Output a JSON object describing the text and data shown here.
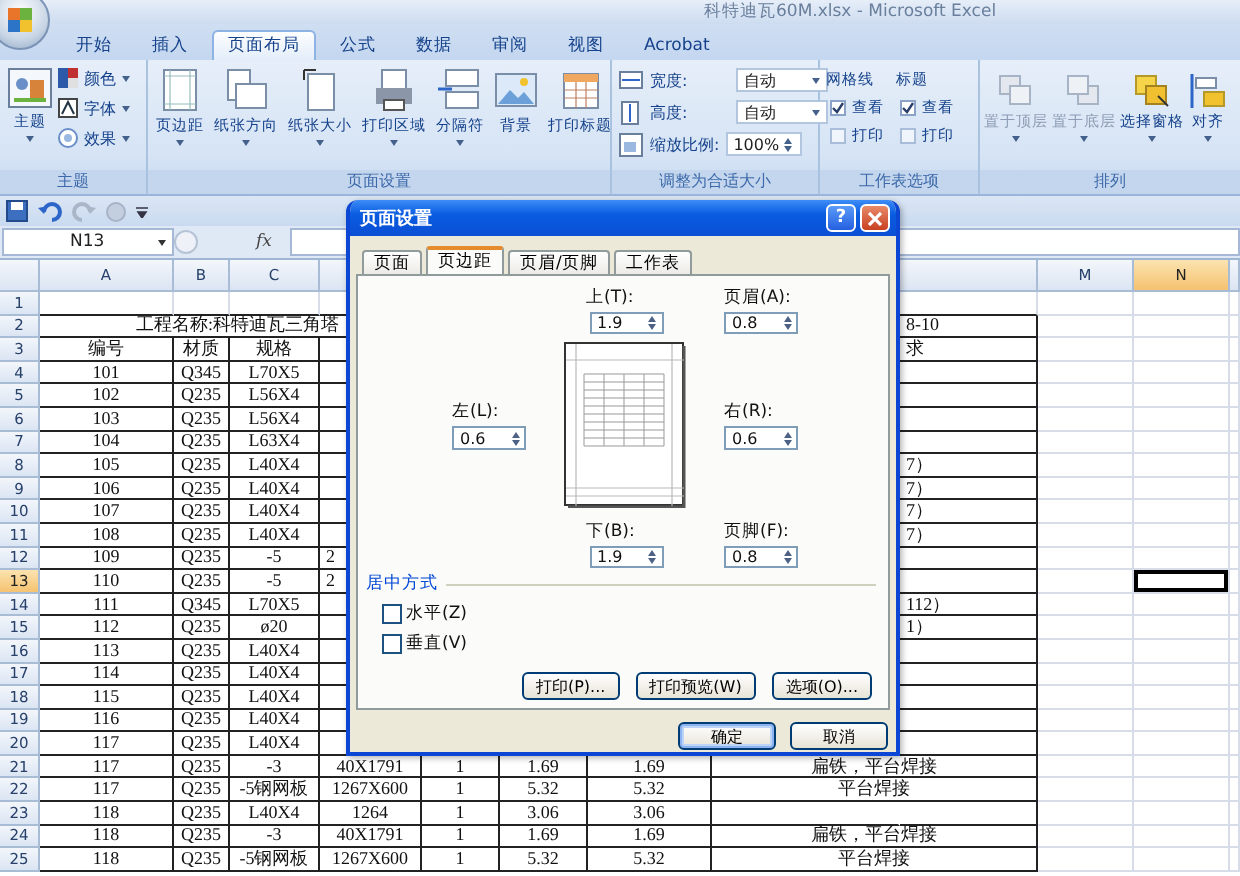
{
  "window": {
    "title": "科特迪瓦60M.xlsx - Microsoft Excel"
  },
  "ribbon_tabs": [
    {
      "label": "开始",
      "selected": false
    },
    {
      "label": "插入",
      "selected": false
    },
    {
      "label": "页面布局",
      "selected": true
    },
    {
      "label": "公式",
      "selected": false
    },
    {
      "label": "数据",
      "selected": false
    },
    {
      "label": "审阅",
      "selected": false
    },
    {
      "label": "视图",
      "selected": false
    },
    {
      "label": "Acrobat",
      "selected": false
    }
  ],
  "ribbon": {
    "themes": {
      "label": "主题",
      "button": "主题",
      "items": [
        "颜色",
        "字体",
        "效果"
      ]
    },
    "page_setup": {
      "label": "页面设置",
      "buttons": [
        {
          "label": "页边距",
          "has_menu": true
        },
        {
          "label": "纸张方向",
          "has_menu": true
        },
        {
          "label": "纸张大小",
          "has_menu": true
        },
        {
          "label": "打印区域",
          "has_menu": true
        },
        {
          "label": "分隔符",
          "has_menu": true
        },
        {
          "label": "背景",
          "has_menu": false
        },
        {
          "label": "打印标题",
          "has_menu": false
        }
      ]
    },
    "scale_to_fit": {
      "label": "调整为合适大小",
      "fields": [
        {
          "kind": "dropdown",
          "label": "宽度:",
          "value": "自动"
        },
        {
          "kind": "dropdown",
          "label": "高度:",
          "value": "自动"
        },
        {
          "kind": "spinner",
          "label": "缩放比例:",
          "value": "100%"
        }
      ]
    },
    "sheet_options": {
      "label": "工作表选项",
      "columns": [
        {
          "title": "网格线",
          "options": [
            {
              "label": "查看",
              "checked": true
            },
            {
              "label": "打印",
              "checked": false
            }
          ]
        },
        {
          "title": "标题",
          "options": [
            {
              "label": "查看",
              "checked": true
            },
            {
              "label": "打印",
              "checked": false
            }
          ]
        }
      ]
    },
    "arrange": {
      "label": "排列",
      "buttons": [
        {
          "label": "置于顶层",
          "disabled": true
        },
        {
          "label": "置于底层",
          "disabled": true
        },
        {
          "label": "选择窗格",
          "disabled": false
        },
        {
          "label": "对齐",
          "disabled": false
        }
      ]
    }
  },
  "formula_bar": {
    "name_box": "N13",
    "function_label": "fx"
  },
  "sheet": {
    "columns": [
      {
        "label": "A",
        "selected": false
      },
      {
        "label": "B",
        "selected": false
      },
      {
        "label": "C",
        "selected": false
      },
      {
        "label": "M",
        "selected": false
      },
      {
        "label": "N",
        "selected": true
      }
    ],
    "rows": [
      {
        "number": "1",
        "kind": "data",
        "selected": false
      },
      {
        "number": "2",
        "kind": "merged",
        "selected": false,
        "cells": {
          "A": "工程名称:科特迪瓦三角塔",
          "H_part": "8-10"
        }
      },
      {
        "number": "3",
        "kind": "data",
        "selected": false,
        "cells": {
          "A": "编号",
          "B": "材质",
          "C": "规格",
          "H_part": "求"
        }
      },
      {
        "number": "4",
        "kind": "data",
        "selected": false,
        "cells": {
          "A": "101",
          "B": "Q345",
          "C": "L70X5"
        }
      },
      {
        "number": "5",
        "kind": "data",
        "selected": false,
        "cells": {
          "A": "102",
          "B": "Q235",
          "C": "L56X4"
        }
      },
      {
        "number": "6",
        "kind": "data",
        "selected": false,
        "cells": {
          "A": "103",
          "B": "Q235",
          "C": "L56X4"
        }
      },
      {
        "number": "7",
        "kind": "data",
        "selected": false,
        "cells": {
          "A": "104",
          "B": "Q235",
          "C": "L63X4"
        }
      },
      {
        "number": "8",
        "kind": "data",
        "selected": false,
        "cells": {
          "A": "105",
          "B": "Q235",
          "C": "L40X4",
          "H_part": "7）"
        }
      },
      {
        "number": "9",
        "kind": "data",
        "selected": false,
        "cells": {
          "A": "106",
          "B": "Q235",
          "C": "L40X4",
          "H_part": "7）"
        }
      },
      {
        "number": "10",
        "kind": "data",
        "selected": false,
        "cells": {
          "A": "107",
          "B": "Q235",
          "C": "L40X4",
          "H_part": "7）"
        }
      },
      {
        "number": "11",
        "kind": "data",
        "selected": false,
        "cells": {
          "A": "108",
          "B": "Q235",
          "C": "L40X4",
          "H_part": "7）"
        }
      },
      {
        "number": "12",
        "kind": "data",
        "selected": false,
        "cells": {
          "A": "109",
          "B": "Q235",
          "C": "-5",
          "D_part": "2"
        }
      },
      {
        "number": "13",
        "kind": "data",
        "selected": true,
        "cells": {
          "A": "110",
          "B": "Q235",
          "C": "-5",
          "D_part": "2"
        }
      },
      {
        "number": "14",
        "kind": "data",
        "selected": false,
        "cells": {
          "A": "111",
          "B": "Q345",
          "C": "L70X5",
          "H_part": "112）"
        }
      },
      {
        "number": "15",
        "kind": "data",
        "selected": false,
        "cells": {
          "A": "112",
          "B": "Q235",
          "C": "ø20",
          "H_part": "1）"
        }
      },
      {
        "number": "16",
        "kind": "data",
        "selected": false,
        "cells": {
          "A": "113",
          "B": "Q235",
          "C": "L40X4"
        }
      },
      {
        "number": "17",
        "kind": "data",
        "selected": false,
        "cells": {
          "A": "114",
          "B": "Q235",
          "C": "L40X4"
        }
      },
      {
        "number": "18",
        "kind": "data",
        "selected": false,
        "cells": {
          "A": "115",
          "B": "Q235",
          "C": "L40X4"
        }
      },
      {
        "number": "19",
        "kind": "data",
        "selected": false,
        "cells": {
          "A": "116",
          "B": "Q235",
          "C": "L40X4"
        }
      },
      {
        "number": "20",
        "kind": "data",
        "selected": false,
        "cells": {
          "A": "117",
          "B": "Q235",
          "C": "L40X4"
        }
      },
      {
        "number": "21",
        "kind": "data",
        "selected": false,
        "cells": {
          "A": "117",
          "B": "Q235",
          "C": "-3",
          "D": "40X1791",
          "E": "1",
          "F": "1.69",
          "G": "1.69",
          "H": "扁铁，平台焊接"
        }
      },
      {
        "number": "22",
        "kind": "data",
        "selected": false,
        "cells": {
          "A": "117",
          "B": "Q235",
          "C": "-5钢网板",
          "D": "1267X600",
          "E": "1",
          "F": "5.32",
          "G": "5.32",
          "H": "平台焊接"
        }
      },
      {
        "number": "23",
        "kind": "data",
        "selected": false,
        "cells": {
          "A": "118",
          "B": "Q235",
          "C": "L40X4",
          "D": "1264",
          "E": "1",
          "F": "3.06",
          "G": "3.06"
        }
      },
      {
        "number": "24",
        "kind": "data",
        "selected": false,
        "cells": {
          "A": "118",
          "B": "Q235",
          "C": "-3",
          "D": "40X1791",
          "E": "1",
          "F": "1.69",
          "G": "1.69",
          "H": "扁铁，平台焊接"
        }
      },
      {
        "number": "25",
        "kind": "data",
        "selected": false,
        "cells": {
          "A": "118",
          "B": "Q235",
          "C": "-5钢网板",
          "D": "1267X600",
          "E": "1",
          "F": "5.32",
          "G": "5.32",
          "H": "平台焊接"
        }
      }
    ]
  },
  "dialog": {
    "title": "页面设置",
    "help_button": "?",
    "tabs": [
      {
        "label": "页面",
        "selected": false
      },
      {
        "label": "页边距",
        "selected": true
      },
      {
        "label": "页眉/页脚",
        "selected": false
      },
      {
        "label": "工作表",
        "selected": false
      }
    ],
    "margins": {
      "top": {
        "label": "上(T):",
        "value": "1.9"
      },
      "header": {
        "label": "页眉(A):",
        "value": "0.8"
      },
      "left": {
        "label": "左(L):",
        "value": "0.6"
      },
      "right": {
        "label": "右(R):",
        "value": "0.6"
      },
      "bottom": {
        "label": "下(B):",
        "value": "1.9"
      },
      "footer": {
        "label": "页脚(F):",
        "value": "0.8"
      }
    },
    "center_on_page": {
      "title": "居中方式",
      "options": [
        {
          "label": "水平(Z)",
          "checked": false
        },
        {
          "label": "垂直(V)",
          "checked": false
        }
      ]
    },
    "buttons": [
      "打印(P)...",
      "打印预览(W)",
      "选项(O)..."
    ],
    "footer_buttons": [
      {
        "label": "确定",
        "default": true
      },
      {
        "label": "取消",
        "default": false
      }
    ]
  }
}
